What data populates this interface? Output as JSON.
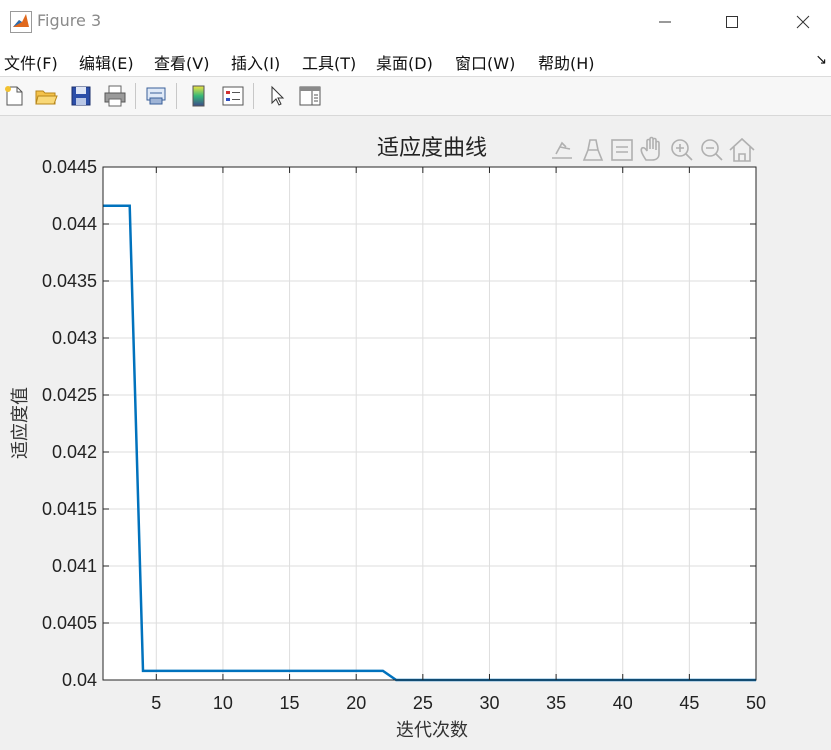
{
  "window": {
    "title": "Figure 3"
  },
  "menu": {
    "items": [
      {
        "label": "文件(F)"
      },
      {
        "label": "编辑(E)"
      },
      {
        "label": "查看(V)"
      },
      {
        "label": "插入(I)"
      },
      {
        "label": "工具(T)"
      },
      {
        "label": "桌面(D)"
      },
      {
        "label": "窗口(W)"
      },
      {
        "label": "帮助(H)"
      }
    ]
  },
  "toolbar": {
    "buttons": [
      {
        "icon": "new-figure-icon"
      },
      {
        "icon": "open-folder-icon"
      },
      {
        "icon": "save-icon"
      },
      {
        "icon": "print-icon"
      },
      {
        "icon": "link-plot-icon"
      },
      {
        "icon": "colorbar-icon"
      },
      {
        "icon": "legend-icon"
      },
      {
        "icon": "pointer-icon"
      },
      {
        "icon": "property-editor-icon"
      }
    ]
  },
  "axes_toolbar": {
    "buttons": [
      {
        "icon": "export-icon"
      },
      {
        "icon": "brush-icon"
      },
      {
        "icon": "data-tips-icon"
      },
      {
        "icon": "pan-hand-icon"
      },
      {
        "icon": "zoom-in-icon"
      },
      {
        "icon": "zoom-out-icon"
      },
      {
        "icon": "home-icon"
      }
    ]
  },
  "chart_data": {
    "type": "line",
    "title": "适应度曲线",
    "xlabel": "迭代次数",
    "ylabel": "适应度值",
    "xlim": [
      1,
      50
    ],
    "ylim": [
      0.04,
      0.0445
    ],
    "xticks": [
      5,
      10,
      15,
      20,
      25,
      30,
      35,
      40,
      45,
      50
    ],
    "xtick_labels": [
      "5",
      "10",
      "15",
      "20",
      "25",
      "30",
      "35",
      "40",
      "45",
      "50"
    ],
    "yticks": [
      0.04,
      0.0405,
      0.041,
      0.0415,
      0.042,
      0.0425,
      0.043,
      0.0435,
      0.044,
      0.0445
    ],
    "ytick_labels": [
      "0.04",
      "0.0405",
      "0.041",
      "0.0415",
      "0.042",
      "0.0425",
      "0.043",
      "0.0435",
      "0.044",
      "0.0445"
    ],
    "grid": true,
    "color": "#0072BD",
    "series": [
      {
        "x": [
          1,
          3,
          4,
          22,
          23,
          50
        ],
        "y": [
          0.04416,
          0.04416,
          0.04008,
          0.04008,
          0.04,
          0.04
        ]
      }
    ]
  }
}
